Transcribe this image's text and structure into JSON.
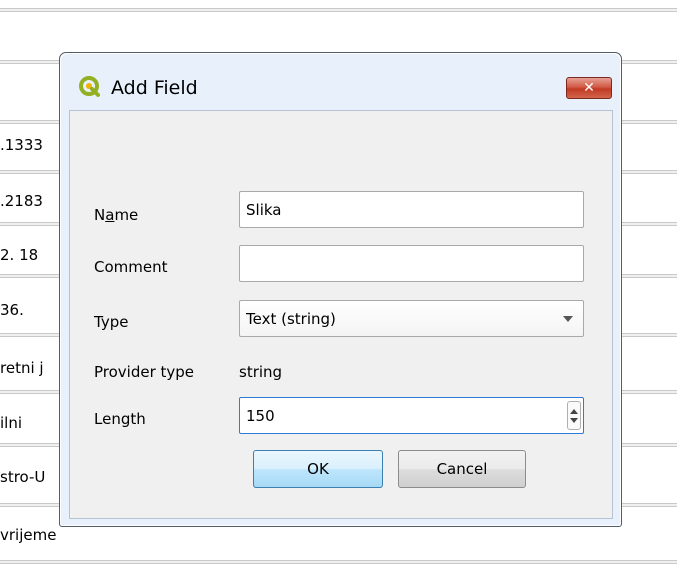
{
  "background_table": {
    "cells": [
      ".1333",
      ".2183",
      "2. 18",
      "36.",
      "retni j",
      "ilni",
      "stro-U",
      "vrijeme"
    ]
  },
  "dialog": {
    "title": "Add Field",
    "close_glyph": "✕",
    "fields": {
      "name_label_pre": "N",
      "name_label_mnemonic": "a",
      "name_label_post": "me",
      "name_value": "Slika",
      "comment_label": "Comment",
      "comment_value": "",
      "type_label": "Type",
      "type_value": "Text (string)",
      "provider_type_label": "Provider type",
      "provider_type_value": "string",
      "length_label": "Length",
      "length_value": "150"
    },
    "buttons": {
      "ok": "OK",
      "cancel": "Cancel"
    }
  },
  "colors": {
    "qgis_green": "#93b023",
    "close_red": "#c23a24",
    "frame_blue": "#e8f1fb"
  }
}
